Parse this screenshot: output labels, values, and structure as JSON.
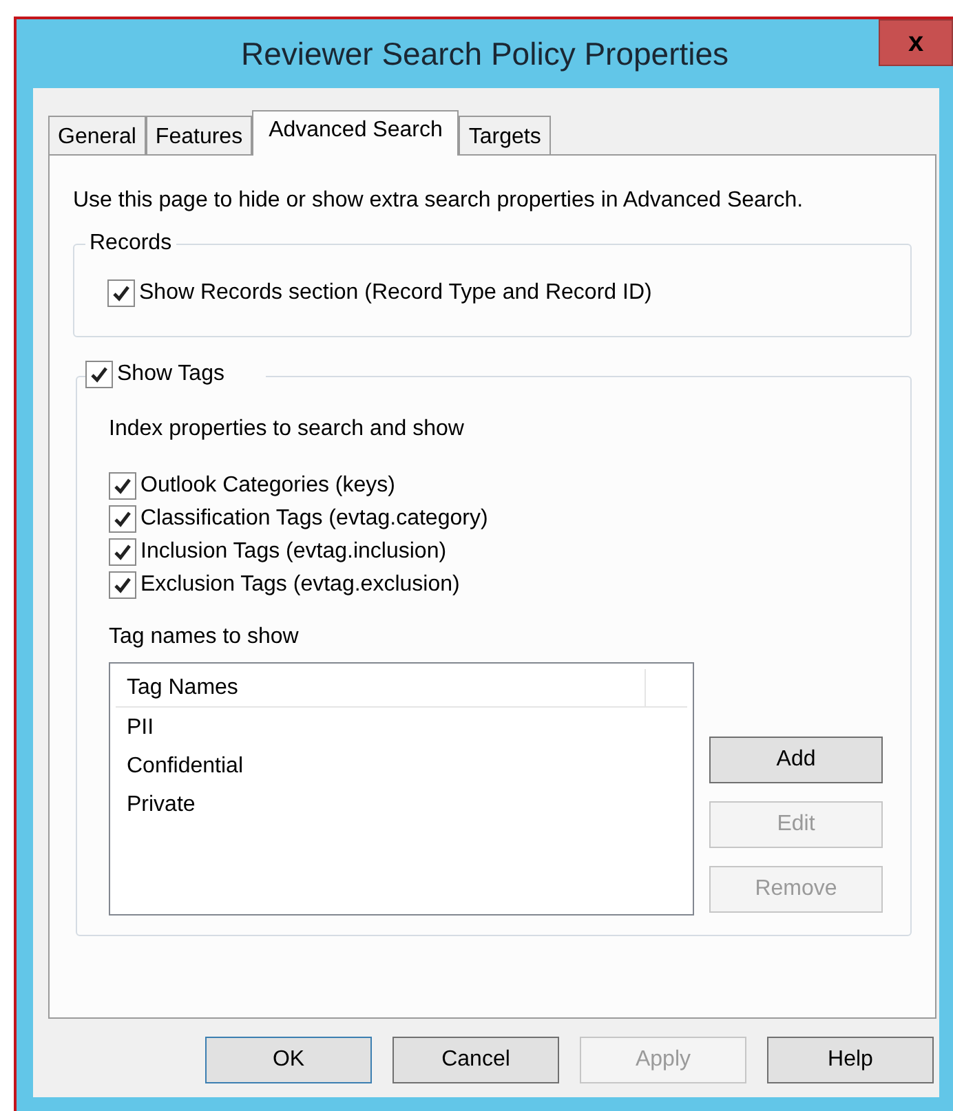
{
  "window": {
    "title": "Reviewer Search Policy Properties",
    "close": "x"
  },
  "tabs": [
    {
      "label": "General",
      "selected": false
    },
    {
      "label": "Features",
      "selected": false
    },
    {
      "label": "Advanced Search",
      "selected": true
    },
    {
      "label": "Targets",
      "selected": false
    }
  ],
  "intro": "Use this page to hide or show extra search properties in Advanced Search.",
  "records": {
    "title": "Records",
    "checkbox": {
      "label": "Show Records section (Record Type and Record ID)",
      "checked": true
    }
  },
  "tags": {
    "checkbox": {
      "label": "Show Tags",
      "checked": true
    },
    "subtitle": "Index properties to search and show",
    "properties": [
      {
        "label": "Outlook Categories (keys)",
        "checked": true
      },
      {
        "label": "Classification Tags (evtag.category)",
        "checked": true
      },
      {
        "label": "Inclusion Tags (evtag.inclusion)",
        "checked": true
      },
      {
        "label": "Exclusion Tags (evtag.exclusion)",
        "checked": true
      }
    ],
    "list_label": "Tag names to show",
    "column": "Tag Names",
    "rows": [
      "PII",
      "Confidential",
      "Private"
    ],
    "buttons": [
      {
        "label": "Add",
        "disabled": false
      },
      {
        "label": "Edit",
        "disabled": true
      },
      {
        "label": "Remove",
        "disabled": true
      }
    ]
  },
  "buttons": [
    {
      "label": "OK",
      "disabled": false,
      "default": true
    },
    {
      "label": "Cancel",
      "disabled": false,
      "default": false
    },
    {
      "label": "Apply",
      "disabled": true,
      "default": false
    },
    {
      "label": "Help",
      "disabled": false,
      "default": false
    }
  ]
}
